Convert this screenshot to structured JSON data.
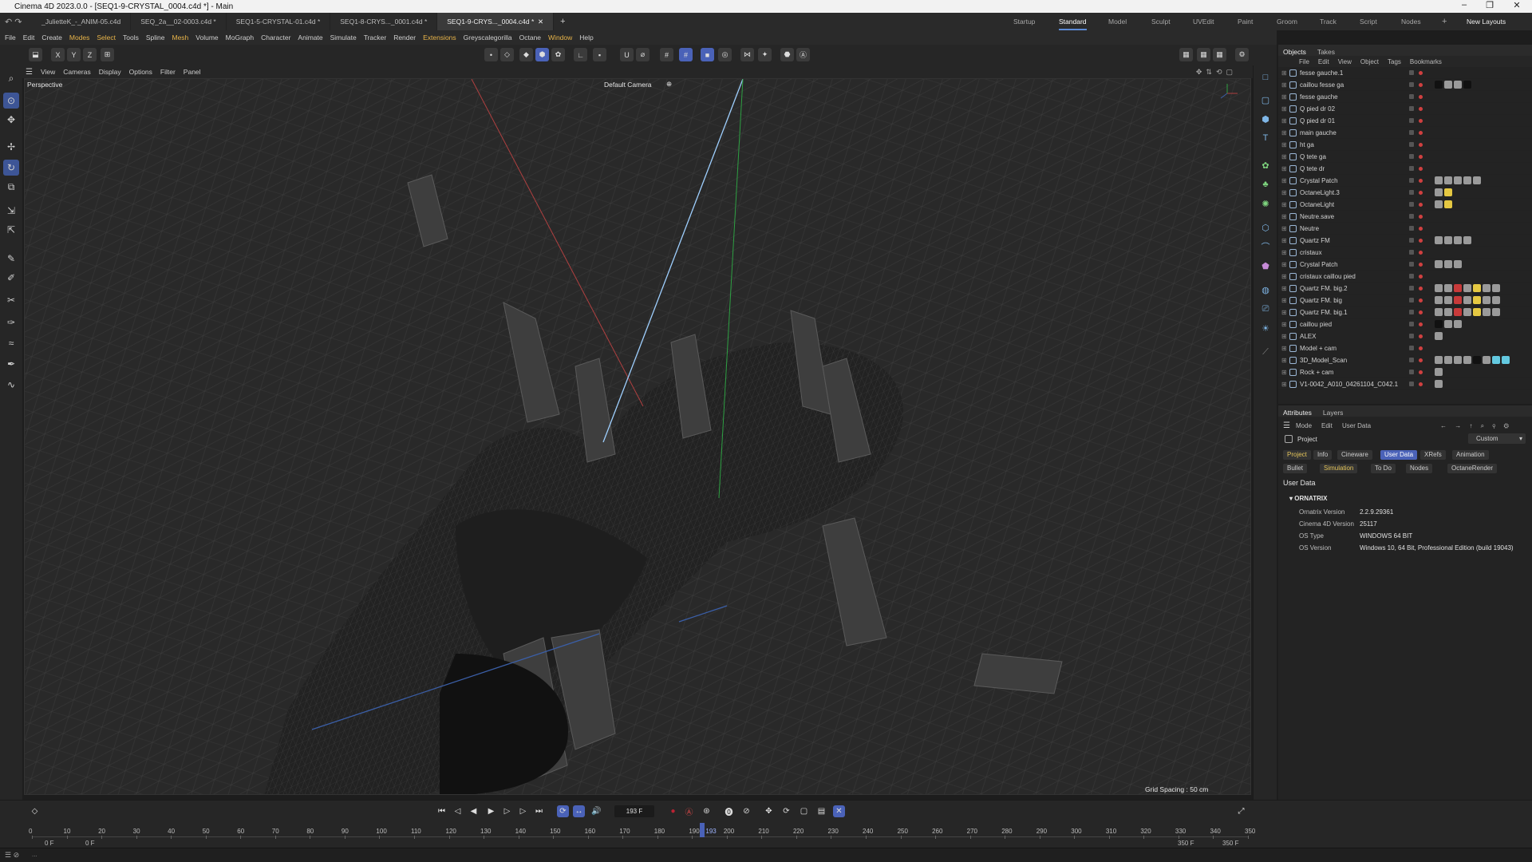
{
  "window": {
    "title": "Cinema 4D 2023.0.0 - [SEQ1-9-CRYSTAL_0004.c4d *] - Main",
    "controls": {
      "minimize": "–",
      "restore": "❐",
      "close": "✕"
    }
  },
  "doc_tabs": [
    "_JulietteK_-_ANIM-05.c4d",
    "SEQ_2a__02-0003.c4d *",
    "SEQ1-5-CRYSTAL-01.c4d *",
    "SEQ1-8-CRYS..._0001.c4d *",
    "SEQ1-9-CRYS..._0004.c4d *"
  ],
  "new_tab": "+",
  "layouts": [
    "Startup",
    "Standard",
    "Model",
    "Sculpt",
    "UVEdit",
    "Paint",
    "Groom",
    "Track",
    "Script",
    "Nodes"
  ],
  "layouts_add": "+",
  "new_layouts": "New Layouts",
  "menu": [
    "File",
    "Edit",
    "Create",
    "Modes",
    "Select",
    "Tools",
    "Spline",
    "Mesh",
    "Volume",
    "MoGraph",
    "Character",
    "Animate",
    "Simulate",
    "Tracker",
    "Render",
    "Extensions",
    "Greyscalegorilla",
    "Octane",
    "Window",
    "Help"
  ],
  "axis_toolbar": [
    "X",
    "Y",
    "Z"
  ],
  "viewport_menu": [
    "View",
    "Cameras",
    "Display",
    "Options",
    "Filter",
    "Panel"
  ],
  "viewport": {
    "projection_label": "Perspective",
    "camera_label": "Default Camera",
    "camera_suffix": "⊕",
    "grid_spacing": "Grid Spacing : 50 cm"
  },
  "objects_panel": {
    "tabs": [
      "Objects",
      "Takes"
    ],
    "menu": [
      "File",
      "Edit",
      "View",
      "Object",
      "Tags",
      "Bookmarks"
    ],
    "rows": [
      {
        "name": "fesse gauche.1",
        "dot": "red",
        "tags": []
      },
      {
        "name": "caillou fesse ga",
        "dot": "red",
        "tags": [
          "d",
          "g",
          "g",
          "d"
        ]
      },
      {
        "name": "fesse gauche",
        "dot": "red",
        "tags": []
      },
      {
        "name": "Q pied dr 02",
        "dot": "red",
        "tags": []
      },
      {
        "name": "Q pied dr 01",
        "dot": "red",
        "tags": []
      },
      {
        "name": "main gauche",
        "dot": "red",
        "tags": []
      },
      {
        "name": "ht ga",
        "dot": "red",
        "tags": []
      },
      {
        "name": "Q tete ga",
        "dot": "red",
        "tags": []
      },
      {
        "name": "Q tete dr",
        "dot": "red",
        "tags": []
      },
      {
        "name": "Crystal Patch",
        "dot": "red",
        "tags": [
          "g",
          "g",
          "g",
          "g",
          "g"
        ]
      },
      {
        "name": "OctaneLight.3",
        "dot": "red",
        "tags": [
          "g",
          "y"
        ]
      },
      {
        "name": "OctaneLight",
        "dot": "red",
        "tags": [
          "g",
          "y"
        ]
      },
      {
        "name": "Neutre.save",
        "dot": "red",
        "tags": []
      },
      {
        "name": "Neutre",
        "dot": "red",
        "tags": []
      },
      {
        "name": "Quartz FM",
        "dot": "red",
        "tags": [
          "g",
          "g",
          "g",
          "g"
        ]
      },
      {
        "name": "cristaux",
        "dot": "red",
        "tags": []
      },
      {
        "name": "Crystal Patch",
        "dot": "red",
        "tags": [
          "g",
          "g",
          "g"
        ]
      },
      {
        "name": "cristaux caillou pied",
        "dot": "red",
        "tags": []
      },
      {
        "name": "Quartz FM. big.2",
        "dot": "red",
        "tags": [
          "g",
          "g",
          "r",
          "g",
          "y",
          "g",
          "g"
        ]
      },
      {
        "name": "Quartz FM. big",
        "dot": "red",
        "tags": [
          "g",
          "g",
          "r",
          "g",
          "y",
          "g",
          "g"
        ]
      },
      {
        "name": "Quartz FM. big.1",
        "dot": "red",
        "tags": [
          "g",
          "g",
          "r",
          "g",
          "y",
          "g",
          "g"
        ]
      },
      {
        "name": "caillou pied",
        "dot": "red",
        "tags": [
          "d",
          "g",
          "g"
        ]
      },
      {
        "name": "ALEX",
        "dot": "red",
        "tags": [
          "g"
        ]
      },
      {
        "name": "Model + cam",
        "dot": "red",
        "tags": []
      },
      {
        "name": "3D_Model_Scan",
        "dot": "red",
        "tags": [
          "g",
          "g",
          "g",
          "g",
          "d",
          "g",
          "c",
          "c"
        ]
      },
      {
        "name": "Rock + cam",
        "dot": "red",
        "tags": [
          "g"
        ]
      },
      {
        "name": "V1-0042_A010_04261104_C042.1",
        "dot": "red",
        "tags": [
          "g"
        ]
      }
    ]
  },
  "attributes_panel": {
    "tabs": [
      "Attributes",
      "Layers"
    ],
    "menu": [
      "Mode",
      "Edit",
      "User Data"
    ],
    "object_label": "Project",
    "preset": "Custom",
    "pill_row1": [
      "Project",
      "Info",
      "Cineware",
      "User Data",
      "XRefs",
      "Animation"
    ],
    "pill_row2": [
      "Bullet",
      "Simulation",
      "To Do",
      "Nodes",
      "OctaneRender"
    ],
    "section": "User Data",
    "group": "ORNATRIX",
    "fields": [
      {
        "label": "Ornatrix Version",
        "value": "2.2.9.29361"
      },
      {
        "label": "Cinema 4D Version",
        "value": "25117"
      },
      {
        "label": "OS Type",
        "value": "WINDOWS 64 BIT"
      },
      {
        "label": "OS Version",
        "value": "Windows 10, 64 Bit, Professional Edition (build 19043)"
      }
    ]
  },
  "timeline": {
    "current_frame": "193 F",
    "playhead_label": "193",
    "ticks": [
      "0",
      "10",
      "20",
      "30",
      "40",
      "50",
      "60",
      "70",
      "80",
      "90",
      "100",
      "110",
      "120",
      "130",
      "140",
      "150",
      "160",
      "170",
      "180",
      "190",
      "200",
      "210",
      "220",
      "230",
      "240",
      "250",
      "260",
      "270",
      "280",
      "290",
      "300",
      "310",
      "320",
      "330",
      "340",
      "350"
    ],
    "range_start": "0 F",
    "range_start2": "0 F",
    "range_end": "350 F",
    "range_end2": "350 F",
    "playhead_frame": 193,
    "total_frames": 350
  },
  "statusbar": {
    "text": "..."
  }
}
